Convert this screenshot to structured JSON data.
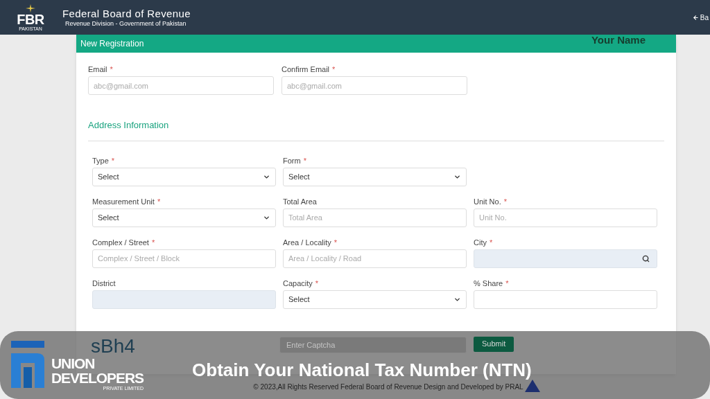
{
  "header": {
    "logo_text": "FBR",
    "logo_subtext": "PAKISTAN",
    "title": "Federal Board of Revenue",
    "subtitle": "Revenue Division - Government of Pakistan",
    "back_link": "Ba"
  },
  "card": {
    "title": "New Registration",
    "user_name": "Your Name"
  },
  "contact_fields": [
    {
      "label": "Email",
      "mark": "*",
      "kind": "text",
      "placeholder": "abc@gmail.com"
    },
    {
      "label": "Confirm Email",
      "mark": "*",
      "kind": "text",
      "placeholder": "abc@gmail.com"
    }
  ],
  "section_title": "Address Information",
  "address_fields": [
    {
      "label": "Type",
      "mark": "*",
      "kind": "select",
      "value": "Select"
    },
    {
      "label": "Form",
      "mark": "*",
      "kind": "select",
      "value": "Select"
    },
    {
      "label": "Measurement Unit",
      "mark": "*",
      "kind": "select",
      "value": "Select"
    },
    {
      "label": "Total Area",
      "kind": "text",
      "placeholder": "Total Area"
    },
    {
      "label": "Unit No.",
      "mark": "*",
      "kind": "text",
      "placeholder": "Unit No."
    },
    {
      "label": "Complex / Street",
      "mark": "*",
      "kind": "text",
      "placeholder": "Complex / Street / Block"
    },
    {
      "label": "Area / Locality",
      "mark": "*",
      "kind": "text",
      "placeholder": "Area / Locality / Road"
    },
    {
      "label": "City",
      "mark": "*",
      "kind": "search"
    },
    {
      "label": "District",
      "kind": "disabled"
    },
    {
      "label": "Capacity",
      "mark": "*",
      "kind": "select",
      "value": "Select"
    },
    {
      "label": "% Share",
      "mark": "*",
      "kind": "text"
    }
  ],
  "captcha": {
    "code": "sBh4",
    "placeholder": "Enter Captcha",
    "submit": "Submit"
  },
  "footer": "© 2023,All Rights Reserved Federal Board of Revenue Design and Developed by PRAL",
  "banner": {
    "brand_line1": "UNION",
    "brand_line2": "DEVELOPERS",
    "brand_line3": "PRIVATE LIMITED",
    "title": "Obtain Your National Tax Number (NTN)"
  }
}
